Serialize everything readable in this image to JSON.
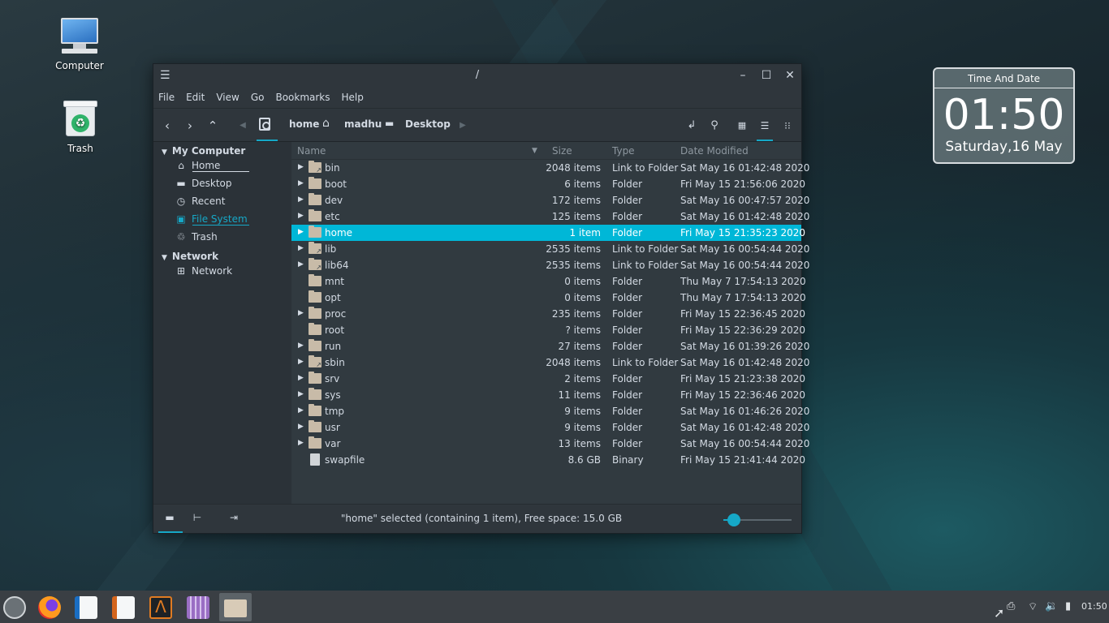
{
  "desktop": {
    "icons": [
      {
        "label": "Computer"
      },
      {
        "label": "Trash"
      }
    ]
  },
  "window": {
    "title": "/",
    "menu": [
      "File",
      "Edit",
      "View",
      "Go",
      "Bookmarks",
      "Help"
    ],
    "breadcrumbs": [
      "home",
      "madhu",
      "Desktop"
    ],
    "sidebar": {
      "sections": [
        {
          "title": "My Computer",
          "items": [
            "Home",
            "Desktop",
            "Recent",
            "File System",
            "Trash"
          ]
        },
        {
          "title": "Network",
          "items": [
            "Network"
          ]
        }
      ],
      "active_item": "File System"
    },
    "columns": {
      "name": "Name",
      "size": "Size",
      "type": "Type",
      "date": "Date Modified"
    },
    "files": [
      {
        "name": "bin",
        "size": "2048 items",
        "type": "Link to Folder",
        "date": "Sat May 16 01:42:48 2020",
        "expandable": true,
        "kind": "link"
      },
      {
        "name": "boot",
        "size": "6 items",
        "type": "Folder",
        "date": "Fri May 15 21:56:06 2020",
        "expandable": true,
        "kind": "folder"
      },
      {
        "name": "dev",
        "size": "172 items",
        "type": "Folder",
        "date": "Sat May 16 00:47:57 2020",
        "expandable": true,
        "kind": "folder"
      },
      {
        "name": "etc",
        "size": "125 items",
        "type": "Folder",
        "date": "Sat May 16 01:42:48 2020",
        "expandable": true,
        "kind": "folder"
      },
      {
        "name": "home",
        "size": "1 item",
        "type": "Folder",
        "date": "Fri May 15 21:35:23 2020",
        "expandable": true,
        "kind": "folder",
        "selected": true
      },
      {
        "name": "lib",
        "size": "2535 items",
        "type": "Link to Folder",
        "date": "Sat May 16 00:54:44 2020",
        "expandable": true,
        "kind": "link"
      },
      {
        "name": "lib64",
        "size": "2535 items",
        "type": "Link to Folder",
        "date": "Sat May 16 00:54:44 2020",
        "expandable": true,
        "kind": "link"
      },
      {
        "name": "mnt",
        "size": "0 items",
        "type": "Folder",
        "date": "Thu May  7 17:54:13 2020",
        "expandable": false,
        "kind": "folder"
      },
      {
        "name": "opt",
        "size": "0 items",
        "type": "Folder",
        "date": "Thu May  7 17:54:13 2020",
        "expandable": false,
        "kind": "folder"
      },
      {
        "name": "proc",
        "size": "235 items",
        "type": "Folder",
        "date": "Fri May 15 22:36:45 2020",
        "expandable": true,
        "kind": "folder"
      },
      {
        "name": "root",
        "size": "? items",
        "type": "Folder",
        "date": "Fri May 15 22:36:29 2020",
        "expandable": false,
        "kind": "folder"
      },
      {
        "name": "run",
        "size": "27 items",
        "type": "Folder",
        "date": "Sat May 16 01:39:26 2020",
        "expandable": true,
        "kind": "folder"
      },
      {
        "name": "sbin",
        "size": "2048 items",
        "type": "Link to Folder",
        "date": "Sat May 16 01:42:48 2020",
        "expandable": true,
        "kind": "link"
      },
      {
        "name": "srv",
        "size": "2 items",
        "type": "Folder",
        "date": "Fri May 15 21:23:38 2020",
        "expandable": true,
        "kind": "folder"
      },
      {
        "name": "sys",
        "size": "11 items",
        "type": "Folder",
        "date": "Fri May 15 22:36:46 2020",
        "expandable": true,
        "kind": "folder"
      },
      {
        "name": "tmp",
        "size": "9 items",
        "type": "Folder",
        "date": "Sat May 16 01:46:26 2020",
        "expandable": true,
        "kind": "folder"
      },
      {
        "name": "usr",
        "size": "9 items",
        "type": "Folder",
        "date": "Sat May 16 01:42:48 2020",
        "expandable": true,
        "kind": "folder"
      },
      {
        "name": "var",
        "size": "13 items",
        "type": "Folder",
        "date": "Sat May 16 00:54:44 2020",
        "expandable": true,
        "kind": "folder"
      },
      {
        "name": "swapfile",
        "size": "8.6 GB",
        "type": "Binary",
        "date": "Fri May 15 21:41:44 2020",
        "expandable": false,
        "kind": "file"
      }
    ],
    "status": "\"home\" selected (containing 1 item), Free space: 15.0 GB",
    "zoom_level": 0.15
  },
  "clock_widget": {
    "header": "Time And Date",
    "time": "01:50",
    "date": "Saturday,16 May"
  },
  "taskbar": {
    "apps": [
      "menu-icon",
      "firefox-icon",
      "writer-icon",
      "impress-icon",
      "text-editor-icon",
      "video-player-icon",
      "file-manager-icon"
    ],
    "active_app": "file-manager-icon",
    "tray_time": "01:50"
  },
  "colors": {
    "accent": "#00b7d7",
    "window_bg": "#2b3238",
    "list_bg": "#313a40"
  }
}
